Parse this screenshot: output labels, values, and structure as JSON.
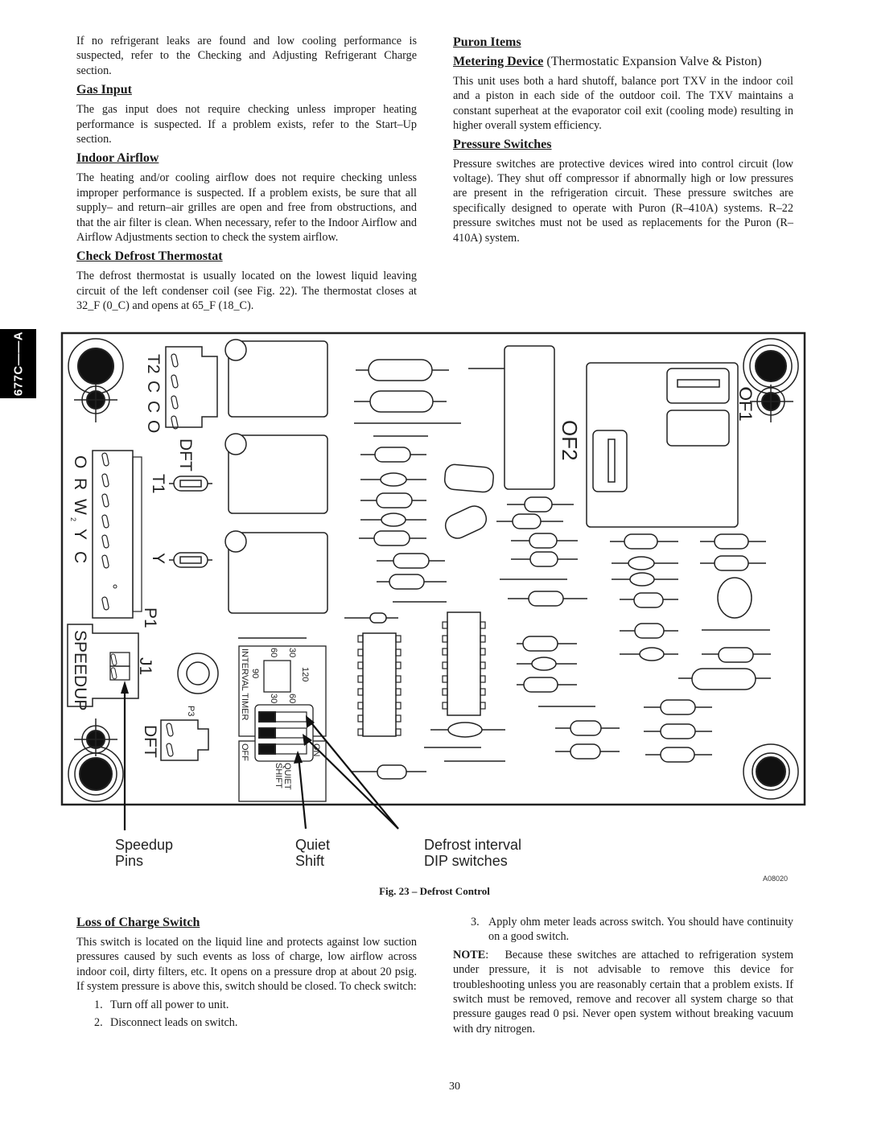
{
  "side_tab": {
    "label": "677C——A"
  },
  "left_column": {
    "intro": "If no refrigerant leaks are found and low cooling performance is suspected, refer to the Checking and Adjusting Refrigerant Charge section.",
    "sections": [
      {
        "heading": "Gas Input",
        "body": "The gas input does not require checking unless improper heating performance is suspected. If a problem exists, refer to the Start–Up section."
      },
      {
        "heading": "Indoor Airflow",
        "body": "The heating and/or cooling airflow does not require checking unless improper performance is suspected. If a problem exists, be sure that all supply– and return–air grilles are open and free from obstructions, and that the air filter is clean. When necessary, refer to the Indoor Airflow and Airflow Adjustments section to check the system airflow."
      },
      {
        "heading": "Check Defrost Thermostat",
        "body": "The defrost thermostat is usually located on the lowest liquid leaving circuit of the left condenser coil (see Fig. 22). The thermostat closes at 32_F (0_C) and opens at 65_F (18_C)."
      }
    ]
  },
  "right_column": {
    "heading": "Puron Items",
    "metering": {
      "heading": "Metering Device",
      "subtitle": " (Thermostatic Expansion Valve  & Piston)",
      "body": "This unit uses both a hard shutoff, balance port TXV in the indoor coil and a piston in each side of the outdoor coil. The TXV maintains a constant superheat at the evaporator coil exit (cooling mode) resulting in higher overall system efficiency."
    },
    "pressure": {
      "heading": "Pressure Switches",
      "body": "Pressure switches are protective devices wired into control circuit (low voltage). They shut off compressor if abnormally high or low pressures are present in the refrigeration circuit. These pressure switches are specifically designed to operate with Puron (R–410A) systems. R–22 pressure switches must not be used as replacements for the Puron (R–410A) system."
    }
  },
  "figure": {
    "board_labels": {
      "t2": "T2",
      "c1": "C",
      "c2": "C",
      "o_top": "O",
      "dft_top": "DFT",
      "o": "O",
      "r": "R",
      "w": "W",
      "w_sub": "2",
      "y": "Y",
      "c": "C",
      "p1": "P1",
      "t1": "T1",
      "y_relay": "Y",
      "j1": "J1",
      "speedup": "SPEEDUP",
      "p3": "P3",
      "dft_bottom": "DFT",
      "of1": "OF1",
      "of2": "OF2",
      "interval_timer": "INTERVAL TIMER",
      "t30a": "30",
      "t60a": "60",
      "t90": "90",
      "t120": "120",
      "t30b": "30",
      "t60b": "60",
      "off": "OFF",
      "on": "ON",
      "quiet_shift": "QUIET",
      "quiet_shift2": "SHIFT"
    },
    "callouts": {
      "speedup_line1": "Speedup",
      "speedup_line2": "Pins",
      "quiet_line1": "Quiet",
      "quiet_line2": "Shift",
      "defrost_line1": "Defrost interval",
      "defrost_line2": "DIP switches"
    },
    "figure_id": "A08020",
    "caption": "Fig. 23 – Defrost Control"
  },
  "loss_of_charge": {
    "heading": "Loss of Charge Switch",
    "body": "This switch is located on the liquid line and protects against low suction pressures caused by such events as loss of charge, low airflow across indoor coil, dirty filters, etc. It opens on a pressure drop at about 20 psig. If system pressure is above this, switch should be closed. To check switch:",
    "steps": [
      {
        "num": "1.",
        "text": "Turn off all power to unit."
      },
      {
        "num": "2.",
        "text": "Disconnect leads on switch."
      },
      {
        "num": "3.",
        "text": "Apply ohm meter leads across switch. You should have continuity on a good switch."
      }
    ],
    "note_label": "NOTE",
    "note_body": ":   Because these switches are attached to refrigeration system under pressure, it is not advisable to remove this device for troubleshooting unless you are reasonably certain that a problem exists. If switch must be removed, remove and recover all system charge so that pressure gauges read 0 psi. Never open system without breaking vacuum with dry nitrogen."
  },
  "page_number": "30"
}
